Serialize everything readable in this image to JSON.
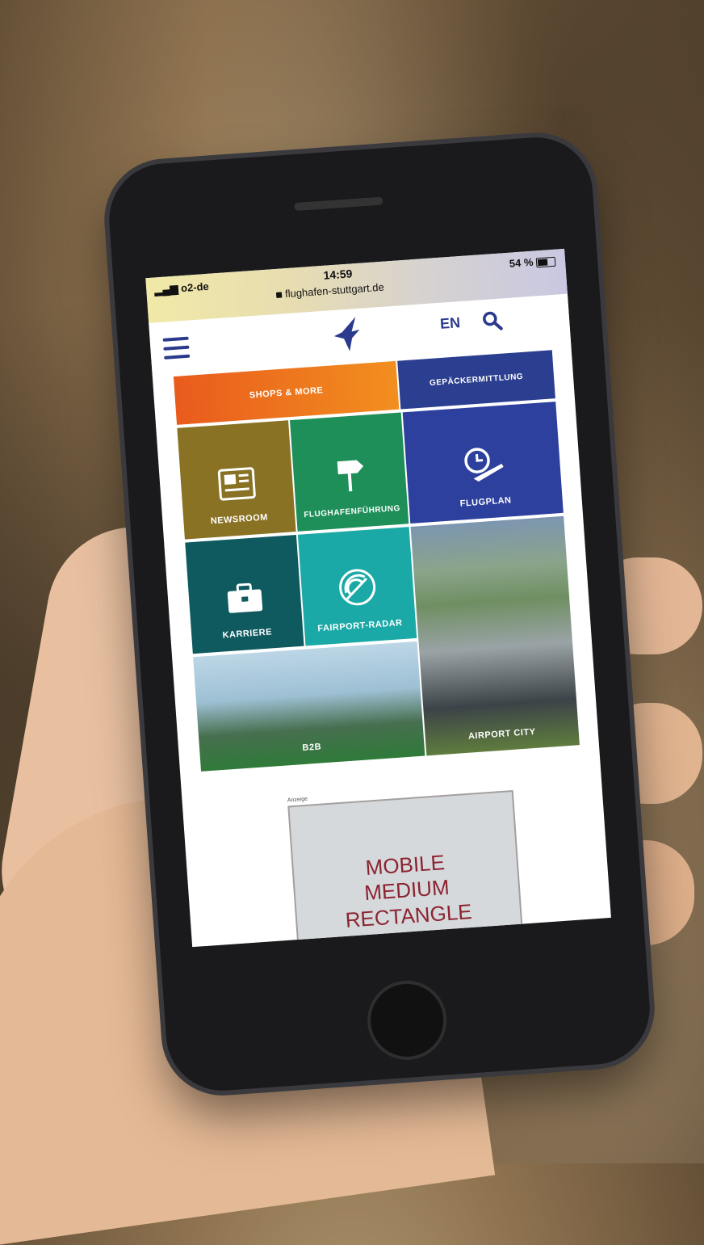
{
  "status_bar": {
    "carrier": "o2-de",
    "time": "14:59",
    "url": "flughafen-stuttgart.de",
    "battery": "54 %"
  },
  "header": {
    "menu_icon": "hamburger-icon",
    "logo_icon": "airport-bird-logo",
    "language": "EN",
    "search_icon": "search-icon"
  },
  "tiles": {
    "shops": "SHOPS & MORE",
    "gepaeck": "GEPÄCKERMITTLUNG",
    "newsroom": "NEWSROOM",
    "fuehrung": "FLUGHAFENFÜHRUNG",
    "flugplan": "FLUGPLAN",
    "karriere": "KARRIERE",
    "radar": "FAIRPORT-RADAR",
    "b2b": "B2B",
    "airport_city": "AIRPORT CITY"
  },
  "colors": {
    "brand_blue": "#2b3a8c",
    "shops_orange": "#e95b1d",
    "news_olive": "#8a7224",
    "green": "#1f8f5a",
    "teal_dark": "#0e5a5f",
    "teal": "#1aa9a6",
    "ad_text": "#8b2430"
  },
  "ad": {
    "label": "Anzeige",
    "text": "MOBILE MEDIUM RECTANGLE"
  }
}
